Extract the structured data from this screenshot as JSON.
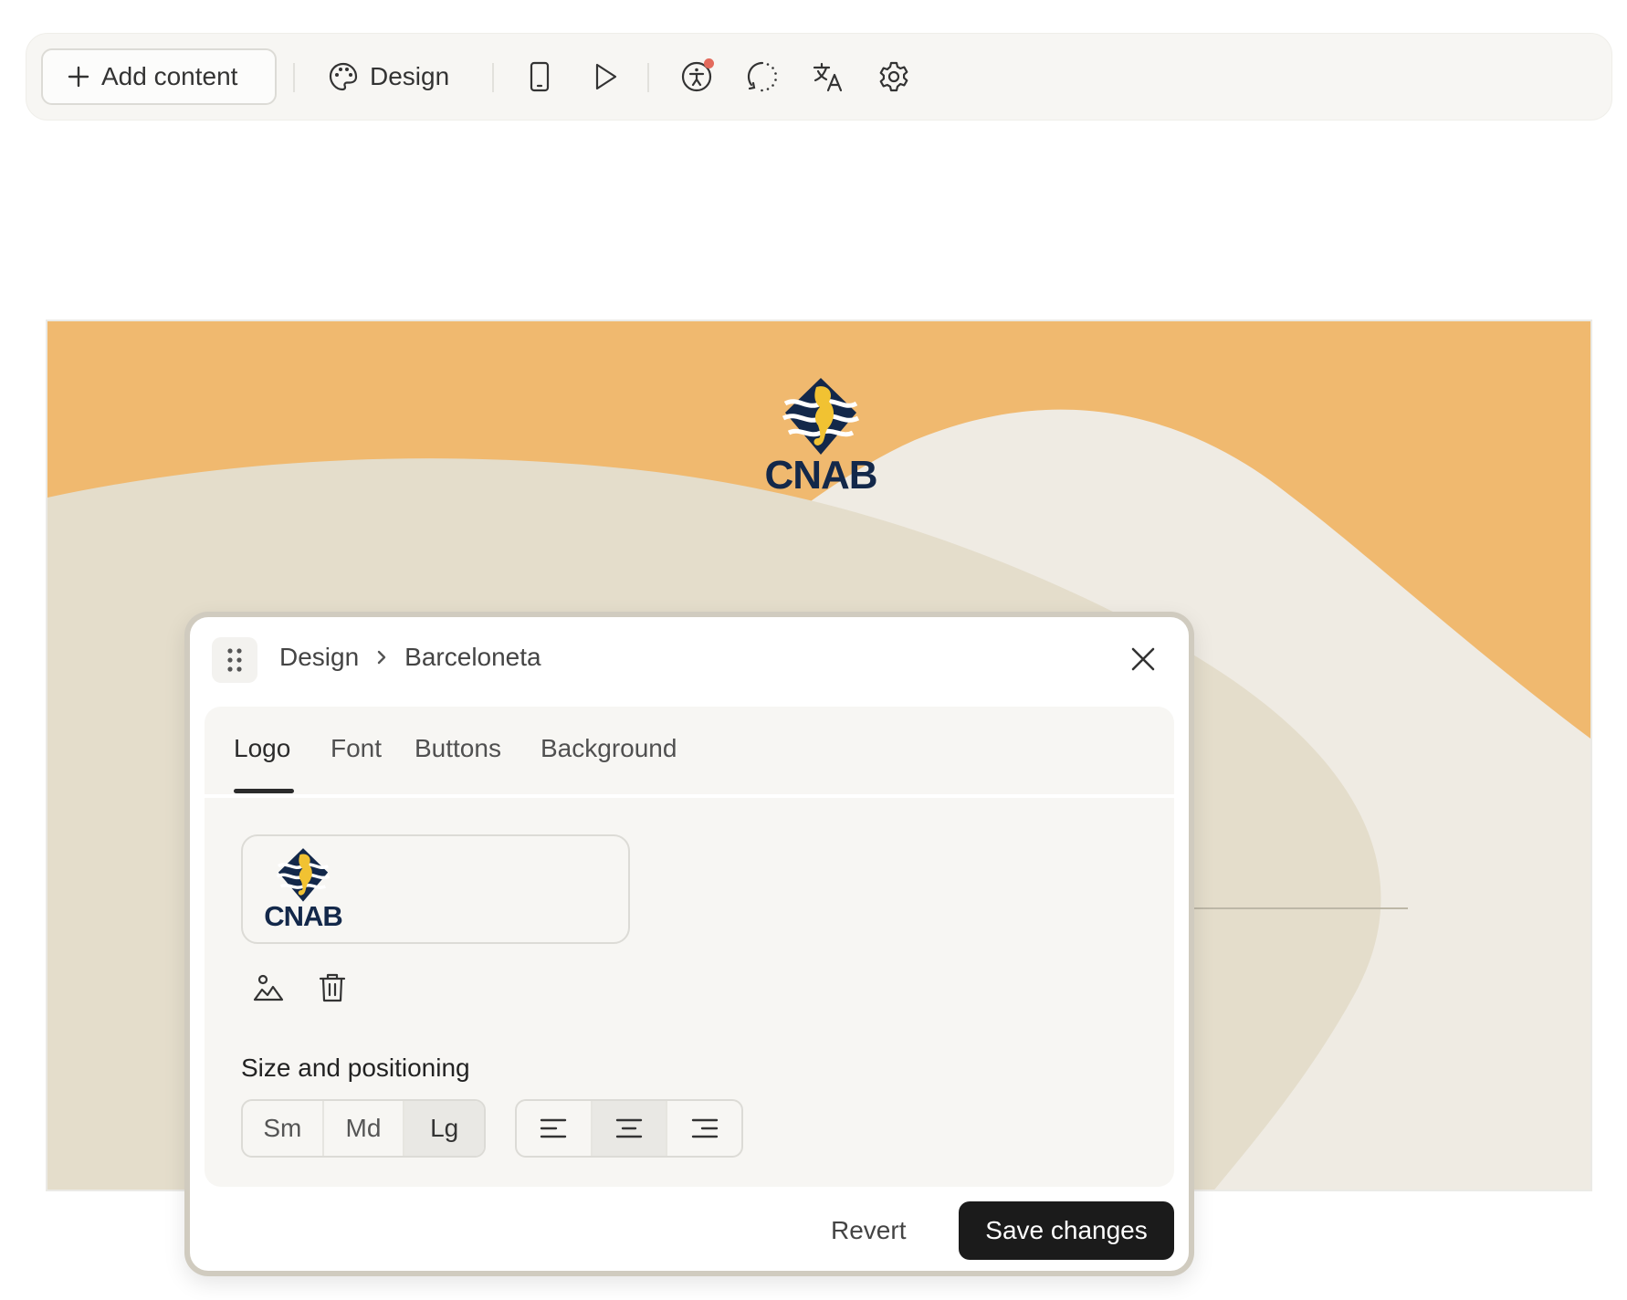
{
  "toolbar": {
    "add_content_label": "Add content",
    "design_label": "Design",
    "icons": [
      "plus-icon",
      "palette-icon",
      "mobile-preview-icon",
      "play-icon",
      "accessibility-icon",
      "loading-circle-icon",
      "translate-icon",
      "gear-icon"
    ],
    "notification_color": "#e36a5c"
  },
  "preview": {
    "logo_wordmark": "CNAB",
    "colors": {
      "top": "#f0b96f",
      "wave_front": "#e4ddcb",
      "wave_back": "#efebe3",
      "logo_navy": "#13284a",
      "logo_yellow": "#f1c232"
    }
  },
  "panel": {
    "breadcrumb": {
      "root": "Design",
      "current": "Barceloneta"
    },
    "tabs": [
      {
        "label": "Logo",
        "active": true
      },
      {
        "label": "Font",
        "active": false
      },
      {
        "label": "Buttons",
        "active": false
      },
      {
        "label": "Background",
        "active": false
      }
    ],
    "logo_preview_wordmark": "CNAB",
    "size_and_positioning_label": "Size and positioning",
    "size_options": [
      {
        "label": "Sm",
        "selected": false
      },
      {
        "label": "Md",
        "selected": false
      },
      {
        "label": "Lg",
        "selected": true
      }
    ],
    "alignment_options": [
      {
        "name": "align-left",
        "selected": false
      },
      {
        "name": "align-center",
        "selected": true
      },
      {
        "name": "align-right",
        "selected": false
      }
    ],
    "revert_label": "Revert",
    "save_label": "Save changes"
  }
}
